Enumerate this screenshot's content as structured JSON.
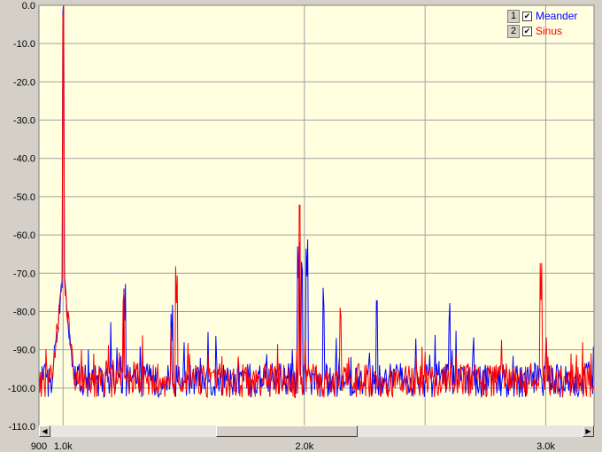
{
  "chart_data": {
    "type": "line",
    "title": "",
    "xlabel": "",
    "ylabel": "",
    "xlim": [
      900,
      3200
    ],
    "ylim": [
      -110,
      0
    ],
    "grid": true,
    "plot_background": "#ffffe0",
    "y_ticks": [
      0,
      -10,
      -20,
      -30,
      -40,
      -50,
      -60,
      -70,
      -80,
      -90,
      -100,
      -110
    ],
    "y_tick_labels": [
      "0.0",
      "-10.0",
      "-20.0",
      "-30.0",
      "-40.0",
      "-50.0",
      "-60.0",
      "-70.0",
      "-80.0",
      "-90.0",
      "-100.0",
      "-110.0"
    ],
    "x_gridlines": [
      1000,
      2000,
      2500,
      3000
    ],
    "x_ticks": [
      900,
      1000,
      2000,
      3000
    ],
    "x_tick_labels": [
      "900",
      "1.0k",
      "2.0k",
      "3.0k"
    ],
    "legend_position": "top-right",
    "series": [
      {
        "name": "Meander",
        "color": "#0000ff",
        "noise_floor": -98,
        "peaks": [
          {
            "x": 1000,
            "y": -4
          },
          {
            "x": 1255,
            "y": -83
          },
          {
            "x": 1450,
            "y": -89
          },
          {
            "x": 1975,
            "y": -72
          },
          {
            "x": 1990,
            "y": -73
          },
          {
            "x": 2010,
            "y": -72
          },
          {
            "x": 2080,
            "y": -81
          },
          {
            "x": 2300,
            "y": -82
          },
          {
            "x": 2600,
            "y": -85
          },
          {
            "x": 3000,
            "y": -94
          }
        ]
      },
      {
        "name": "Sinus",
        "color": "#ff0000",
        "noise_floor": -98,
        "peaks": [
          {
            "x": 1000,
            "y": -6
          },
          {
            "x": 1250,
            "y": -81
          },
          {
            "x": 1470,
            "y": -79
          },
          {
            "x": 1980,
            "y": -57
          },
          {
            "x": 2150,
            "y": -85
          },
          {
            "x": 2980,
            "y": -77
          },
          {
            "x": 3000,
            "y": -94
          }
        ]
      }
    ]
  },
  "legend": {
    "items": [
      {
        "number": "1",
        "check": "✔",
        "label": "Meander",
        "color": "#0000ff"
      },
      {
        "number": "2",
        "check": "✔",
        "label": "Sinus",
        "color": "#ff0000"
      }
    ]
  },
  "scrollbar": {
    "left_icon": "arrow-left-icon",
    "right_icon": "arrow-right-icon"
  }
}
